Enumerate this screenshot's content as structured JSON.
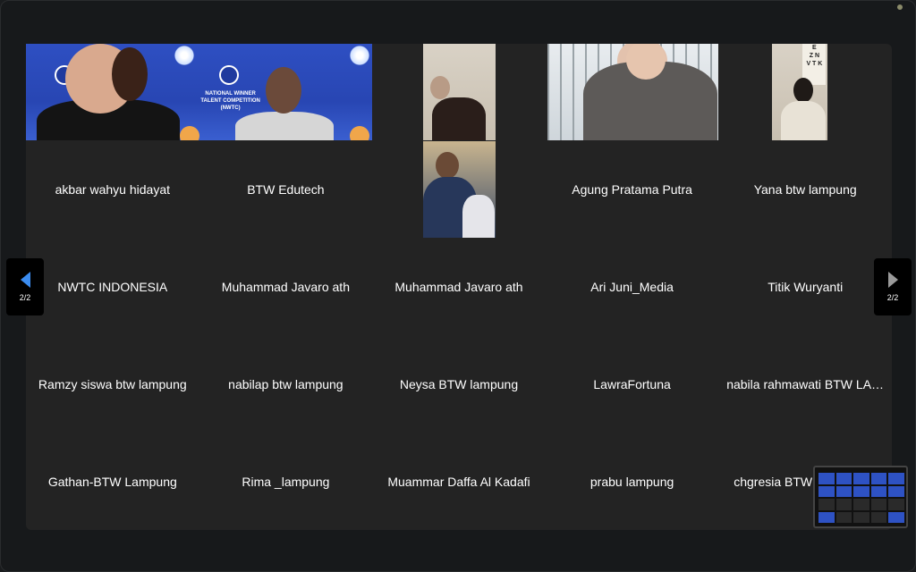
{
  "page": {
    "indicator": "2/2"
  },
  "participants": [
    {
      "name": "akbar wahyu hidayat"
    },
    {
      "name": "BTW Edutech"
    },
    {
      "name": ""
    },
    {
      "name": "Agung Pratama Putra"
    },
    {
      "name": "Yana btw lampung"
    },
    {
      "name": "NWTC INDONESIA"
    },
    {
      "name": "Muhammad Javaro ath"
    },
    {
      "name": "Muhammad Javaro ath"
    },
    {
      "name": "Ari Juni_Media"
    },
    {
      "name": "Titik Wuryanti"
    },
    {
      "name": "Ramzy siswa btw lampung"
    },
    {
      "name": "nabilap btw lampung"
    },
    {
      "name": "Neysa BTW lampung"
    },
    {
      "name": "LawraFortuna"
    },
    {
      "name": "nabila rahmawati BTW LAMPUNG"
    },
    {
      "name": "Gathan-BTW Lampung"
    },
    {
      "name": "Rima _lampung"
    },
    {
      "name": "Muammar Daffa Al Kadafi"
    },
    {
      "name": "prabu lampung"
    },
    {
      "name": "chgresia BTW"
    }
  ],
  "banner": {
    "text_1": "NATIONAL WINNER TALENT COMPETITION",
    "text_2": "NATIONAL WINNER TALENT COMPETITION (NWTC)",
    "logo": "NWTC"
  },
  "eye_chart": "E\nZ N\nV T K",
  "icons": {
    "prev": "triangle-left",
    "next": "triangle-right"
  },
  "colors": {
    "accent": "#3b8cf0",
    "banner_blue": "#2e4fc2",
    "tile_bg": "#232323"
  }
}
